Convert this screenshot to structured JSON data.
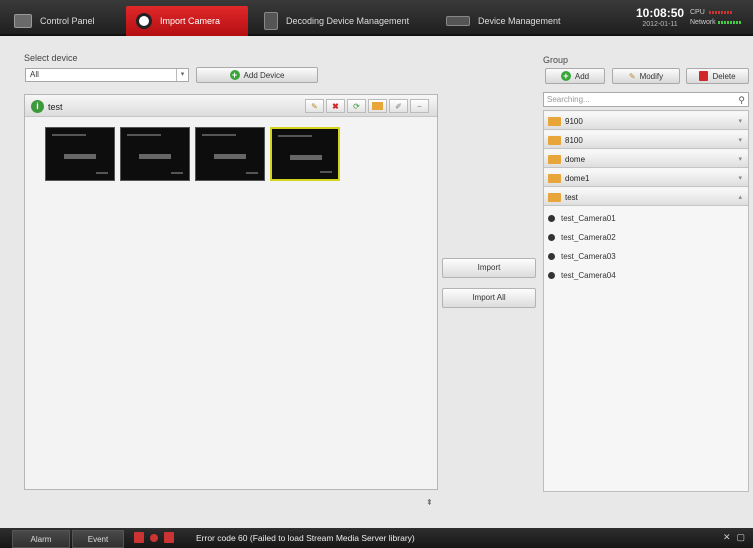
{
  "topbar": {
    "tabs": [
      {
        "label": "Control Panel",
        "active": false
      },
      {
        "label": "Import Camera",
        "active": true
      },
      {
        "label": "Decoding Device Management",
        "active": false
      },
      {
        "label": "Device Management",
        "active": false
      }
    ],
    "clock": {
      "time": "10:08:50",
      "date": "2012-01-11"
    },
    "meters": {
      "cpu_label": "CPU",
      "network_label": "Network"
    }
  },
  "left": {
    "select_label": "Select device",
    "select_value": "All",
    "add_device_label": "Add Device",
    "device_panel": {
      "title": "test",
      "thumbnails": [
        {
          "selected": false
        },
        {
          "selected": false
        },
        {
          "selected": false
        },
        {
          "selected": true
        }
      ]
    },
    "collapse_glyph": "⇞"
  },
  "middle": {
    "import_label": "Import",
    "import_all_label": "Import All"
  },
  "right": {
    "group_label": "Group",
    "add_label": "Add",
    "modify_label": "Modify",
    "delete_label": "Delete",
    "search_placeholder": "Searching...",
    "groups": [
      "9100",
      "8100",
      "dome",
      "dome1",
      "test"
    ],
    "cameras": [
      "test_Camera01",
      "test_Camera02",
      "test_Camera03",
      "test_Camera04"
    ]
  },
  "bottombar": {
    "alarm_label": "Alarm",
    "event_label": "Event",
    "status_message": "Error code 60 (Failed to load Stream Media Server library)"
  },
  "colors": {
    "active_tab": "#c8191c",
    "folder": "#e8a63a",
    "selected_thumb": "#d4d41c"
  }
}
